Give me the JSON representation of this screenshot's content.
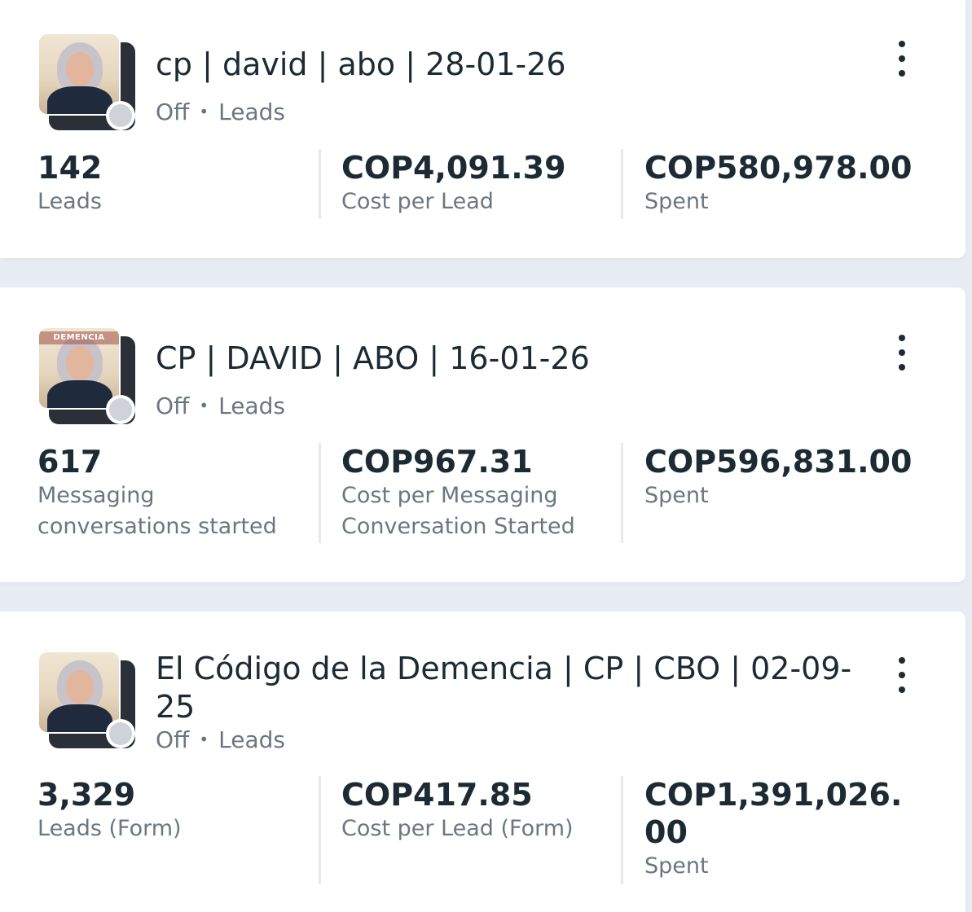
{
  "campaigns": [
    {
      "title": "cp | david | abo | 28-01-26",
      "status": "Off",
      "objective": "Leads",
      "thumbnail_banner": "",
      "metrics": [
        {
          "value": "142",
          "label": "Leads"
        },
        {
          "value": "COP4,091.39",
          "label": "Cost per Lead"
        },
        {
          "value": "COP580,978.00",
          "label": "Spent"
        }
      ]
    },
    {
      "title": "CP | DAVID | ABO | 16-01-26",
      "status": "Off",
      "objective": "Leads",
      "thumbnail_banner": "DEMENCIA",
      "metrics": [
        {
          "value": "617",
          "label": "Messaging conversations started"
        },
        {
          "value": "COP967.31",
          "label": "Cost per Messaging Conversation Started"
        },
        {
          "value": "COP596,831.00",
          "label": "Spent"
        }
      ]
    },
    {
      "title": "El Código de la Demencia | CP | CBO | 02-09-25",
      "status": "Off",
      "objective": "Leads",
      "thumbnail_banner": "",
      "metrics": [
        {
          "value": "3,329",
          "label": "Leads (Form)"
        },
        {
          "value": "COP417.85",
          "label": "Cost per Lead (Form)"
        },
        {
          "value": "COP1,391,026.00",
          "label": "Spent"
        }
      ]
    }
  ],
  "icons": {
    "more": "more-vertical-icon",
    "status": "status-off-dot-icon"
  },
  "colors": {
    "background": "#e8ecf3",
    "card": "#ffffff",
    "text_primary": "#1c2b33",
    "text_secondary": "#6b7780",
    "status_off": "#cfd3d9"
  }
}
